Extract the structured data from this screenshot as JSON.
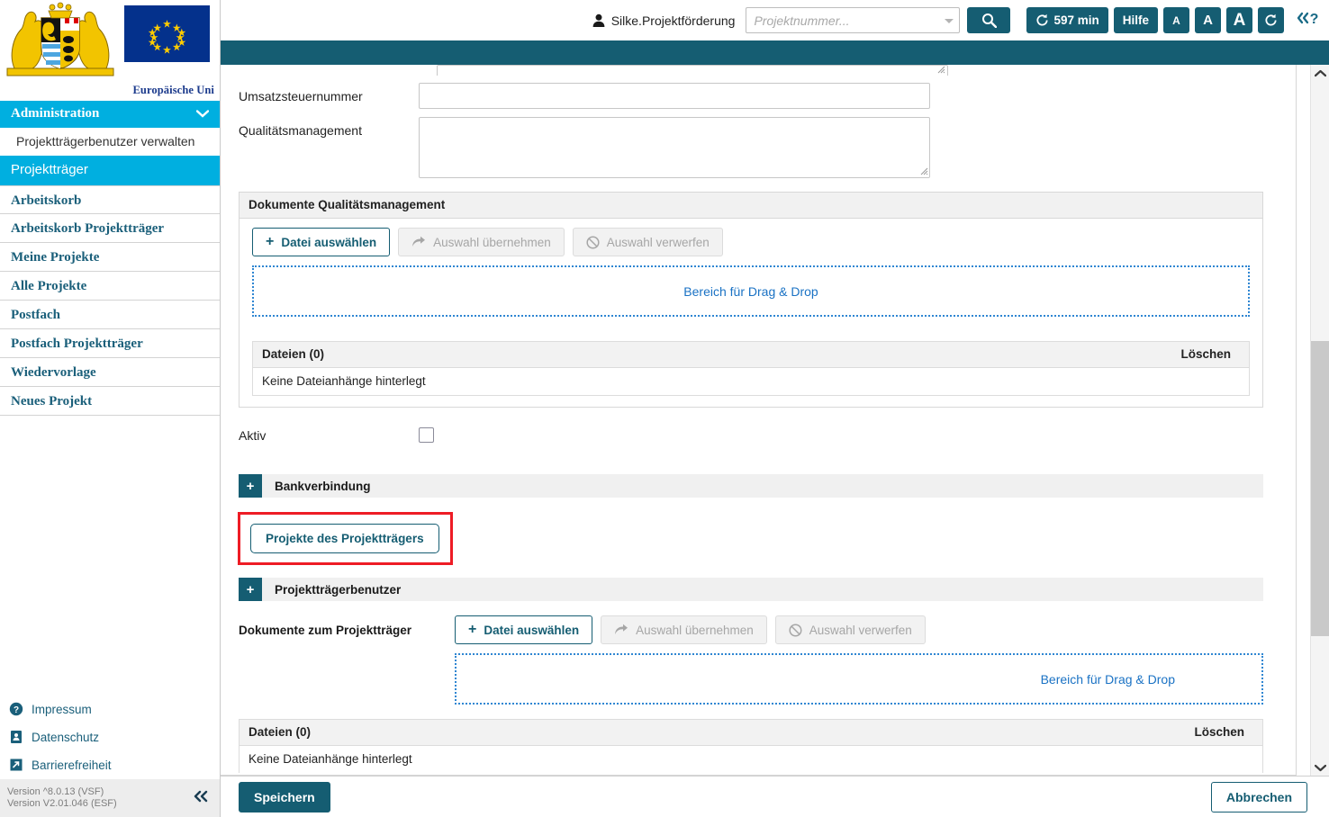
{
  "branding": {
    "coat_of_arms_alt": "Bayerisches Staatswappen",
    "eu_flag_alt": "Flagge der Europäischen Union",
    "eu_caption": "Europäische Uni"
  },
  "sidebar": {
    "section_header": {
      "label": "Administration",
      "chevron": "⌄"
    },
    "sub_item": {
      "label": "Projektträgerbenutzer verwalten"
    },
    "active_item": {
      "label": "Projektträger"
    },
    "items": [
      {
        "label": "Arbeitskorb"
      },
      {
        "label": "Arbeitskorb Projektträger"
      },
      {
        "label": "Meine Projekte"
      },
      {
        "label": "Alle Projekte"
      },
      {
        "label": "Postfach"
      },
      {
        "label": "Postfach Projektträger"
      },
      {
        "label": "Wiedervorlage"
      },
      {
        "label": "Neues Projekt"
      }
    ],
    "footer_links": [
      {
        "label": "Impressum",
        "icon": "question-circle-icon"
      },
      {
        "label": "Datenschutz",
        "icon": "document-privacy-icon"
      },
      {
        "label": "Barrierefreiheit",
        "icon": "accessibility-arrow-icon"
      }
    ],
    "version_line_1": "Version ^8.0.13 (VSF)",
    "version_line_2": "Version V2.01.046 (ESF)",
    "collapse_label": "«"
  },
  "topbar": {
    "user_name": "Silke.Projektförderung",
    "search_placeholder": "Projektnummer...",
    "search_value": "",
    "search_button_icon": "search-icon",
    "session_timer": "597 min",
    "help_label": "Hilfe",
    "font_small": "A",
    "font_medium": "A",
    "font_large": "A",
    "refresh_icon": "refresh-icon",
    "help_toggle": "«?"
  },
  "form": {
    "umsatzsteuernummer": {
      "label": "Umsatzsteuernummer",
      "value": ""
    },
    "qualitaetsmanagement": {
      "label": "Qualitätsmanagement",
      "value": ""
    },
    "aktiv": {
      "label": "Aktiv",
      "checked": false
    }
  },
  "dokumente_qm": {
    "panel_title": "Dokumente Qualitätsmanagement",
    "buttons": {
      "select_file": "Datei auswählen",
      "apply_selection": "Auswahl übernehmen",
      "discard_selection": "Auswahl verwerfen"
    },
    "dropzone_text": "Bereich für Drag & Drop",
    "table": {
      "col_files": "Dateien (0)",
      "col_delete": "Löschen",
      "empty_text": "Keine Dateianhänge hinterlegt"
    }
  },
  "sections": {
    "bankverbindung": {
      "label": "Bankverbindung",
      "expand": "+"
    },
    "projekttraegerbenutzer": {
      "label": "Projektträgerbenutzer",
      "expand": "+"
    }
  },
  "highlighted_button": {
    "label": "Projekte des Projektträgers",
    "highlight_color": "#ee1c25"
  },
  "dokumente_pt": {
    "label": "Dokumente zum Projektträger",
    "buttons": {
      "select_file": "Datei auswählen",
      "apply_selection": "Auswahl übernehmen",
      "discard_selection": "Auswahl verwerfen"
    },
    "dropzone_text": "Bereich für Drag & Drop",
    "table": {
      "col_files": "Dateien (0)",
      "col_delete": "Löschen",
      "empty_text": "Keine Dateianhänge hinterlegt"
    }
  },
  "footer": {
    "save_label": "Speichern",
    "cancel_label": "Abbrechen"
  },
  "colors": {
    "teal": "#155d72",
    "cyan": "#00afe0",
    "link_blue": "#1a72c4",
    "highlight_red": "#ee1c25"
  }
}
